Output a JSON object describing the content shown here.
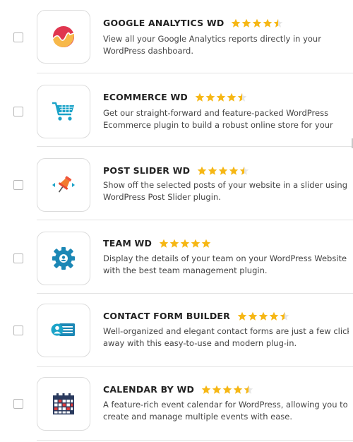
{
  "plugins": [
    {
      "title": "GOOGLE ANALYTICS WD",
      "rating": 4.5,
      "desc_line1": "View all your Google Analytics reports directly in your",
      "desc_line2": "WordPress dashboard.",
      "icon": "analytics-chart-icon"
    },
    {
      "title": "ECOMMERCE WD",
      "rating": 4.5,
      "desc_line1": "Get our straight-forward and feature-packed WordPress",
      "desc_line2": "Ecommerce plugin to build a robust online store for your",
      "icon": "shopping-cart-icon"
    },
    {
      "title": "POST SLIDER WD",
      "rating": 4.5,
      "desc_line1": "Show off the selected posts of your website in a slider using",
      "desc_line2": "WordPress Post Slider plugin.",
      "icon": "pin-slider-icon"
    },
    {
      "title": "TEAM WD",
      "rating": 5,
      "desc_line1": "Display the details of your team on your WordPress Website",
      "desc_line2": "with the best team management plugin.",
      "icon": "team-gear-icon"
    },
    {
      "title": "CONTACT FORM BUILDER",
      "rating": 4.5,
      "desc_line1": "Well-organized and elegant contact forms are just a few clicks",
      "desc_line2": "away with this easy-to-use and modern plug-in.",
      "icon": "contact-card-icon"
    },
    {
      "title": "CALENDAR BY WD",
      "rating": 4.5,
      "desc_line1": "A feature-rich event calendar for WordPress, allowing you to",
      "desc_line2": "create and manage multiple events with ease.",
      "icon": "calendar-icon"
    }
  ],
  "colors": {
    "star": "#f6b715",
    "star_empty": "#e6e6e6"
  }
}
